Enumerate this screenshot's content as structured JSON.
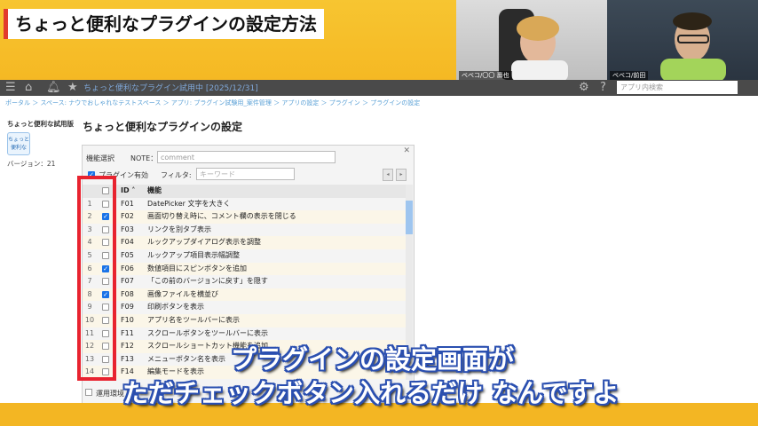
{
  "banner": {
    "title": "ちょっと便利なプラグインの設定方法"
  },
  "cameras": {
    "left_label": "ベベコ/〇〇 壽也",
    "right_label": "ベベコ/前田"
  },
  "header": {
    "app_title": "ちょっと便利なプラグイン試用中 [2025/12/31]",
    "search_placeholder": "アプリ内検索",
    "icons": [
      "menu-icon",
      "home-icon",
      "bell-icon",
      "star-icon",
      "gear-icon",
      "help-icon",
      "search-icon"
    ]
  },
  "breadcrumb": "ポータル ＞ スペース: ナウでおしゃれなテストスペース ＞ アプリ: プラグイン試験用_案件管理 ＞ アプリの設定 ＞ プラグイン ＞ プラグインの設定",
  "sidebar": {
    "app_name": "ちょっと便利な試用版",
    "icon_text": "ちょっと便利な",
    "version": "バージョン：21"
  },
  "page_title": "ちょっと便利なプラグインの設定",
  "dialog": {
    "feature_select_label": "機能選択",
    "note_label": "NOTE：",
    "note_value": "comment",
    "plugin_enabled_label": "プラグイン有効",
    "filter_label": "フィルタ:",
    "filter_placeholder": "キーワード",
    "table_headers": {
      "id": "ID ˄",
      "name": "機能"
    },
    "rows": [
      {
        "num": "1",
        "id": "F01",
        "name": "DatePicker 文字を大きく",
        "checked": false
      },
      {
        "num": "2",
        "id": "F02",
        "name": "画面切り替え時に、コメント欄の表示を閉じる",
        "checked": true
      },
      {
        "num": "3",
        "id": "F03",
        "name": "リンクを別タブ表示",
        "checked": false
      },
      {
        "num": "4",
        "id": "F04",
        "name": "ルックアップダイアログ表示を調整",
        "checked": false
      },
      {
        "num": "5",
        "id": "F05",
        "name": "ルックアップ項目表示幅調整",
        "checked": false
      },
      {
        "num": "6",
        "id": "F06",
        "name": "数値項目にスピンボタンを追加",
        "checked": true
      },
      {
        "num": "7",
        "id": "F07",
        "name": "「この前のバージョンに戻す」を隠す",
        "checked": false
      },
      {
        "num": "8",
        "id": "F08",
        "name": "画像ファイルを横並び",
        "checked": true
      },
      {
        "num": "9",
        "id": "F09",
        "name": "印刷ボタンを表示",
        "checked": false
      },
      {
        "num": "10",
        "id": "F10",
        "name": "アプリ名をツールバーに表示",
        "checked": false
      },
      {
        "num": "11",
        "id": "F11",
        "name": "スクロールボタンをツールバーに表示",
        "checked": false
      },
      {
        "num": "12",
        "id": "F12",
        "name": "スクロールショートカット機能を追加",
        "checked": false
      },
      {
        "num": "13",
        "id": "F13",
        "name": "メニューボタン名を表示",
        "checked": false
      },
      {
        "num": "14",
        "id": "F14",
        "name": "編集モードを表示",
        "checked": false
      }
    ],
    "env_label": "運用環境"
  },
  "captions": {
    "line1": "プラグインの設定画面が",
    "line2": "ただチェックボタン入れるだけ なんですよ"
  },
  "colors": {
    "banner": "#f5b823",
    "highlight": "#e8232f",
    "caption_outline": "#2a4fb0",
    "check": "#1a73e8"
  }
}
